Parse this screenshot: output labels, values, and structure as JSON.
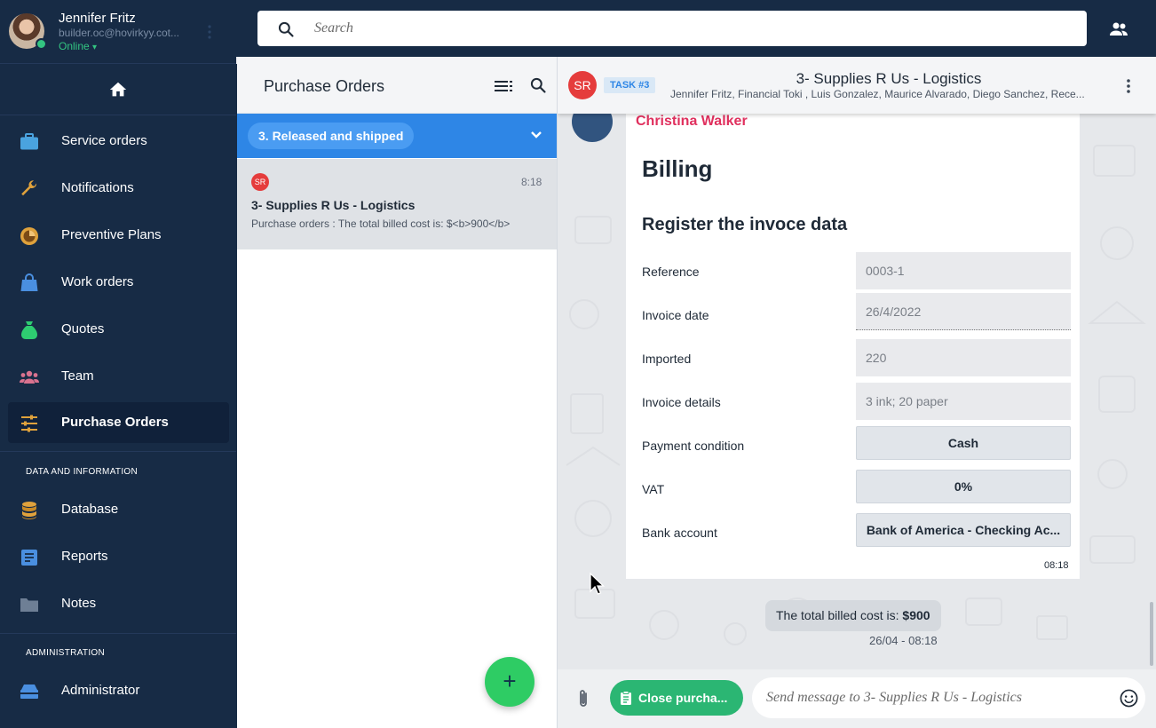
{
  "user": {
    "name": "Jennifer Fritz",
    "email": "builder.oc@hovirkyy.cot...",
    "status": "Online",
    "status_caret": "▾"
  },
  "search": {
    "placeholder": "Search"
  },
  "sidebar": {
    "items": [
      {
        "label": "Service orders",
        "icon": "briefcase-icon",
        "color": "#4aa3df"
      },
      {
        "label": "Notifications",
        "icon": "wrench-icon",
        "color": "#e0a23c"
      },
      {
        "label": "Preventive Plans",
        "icon": "gauge-icon",
        "color": "#e0a23c"
      },
      {
        "label": "Work orders",
        "icon": "bag-icon",
        "color": "#4a8fe0"
      },
      {
        "label": "Quotes",
        "icon": "money-bag-icon",
        "color": "#2ecc71"
      },
      {
        "label": "Team",
        "icon": "people-icon",
        "color": "#d9728f"
      },
      {
        "label": "Purchase Orders",
        "icon": "sliders-icon",
        "color": "#e0a23c"
      }
    ],
    "section_data": "DATA AND INFORMATION",
    "data_items": [
      {
        "label": "Database",
        "icon": "database-icon",
        "color": "#e0a23c"
      },
      {
        "label": "Reports",
        "icon": "report-icon",
        "color": "#4a8fe0"
      },
      {
        "label": "Notes",
        "icon": "folder-icon",
        "color": "#6e7f95"
      }
    ],
    "section_admin": "ADMINISTRATION",
    "admin_items": [
      {
        "label": "Administrator",
        "icon": "toolbox-icon",
        "color": "#4a8fe0"
      }
    ]
  },
  "list": {
    "title": "Purchase Orders",
    "status_filter": "3. Released and shipped",
    "order": {
      "badge": "SR",
      "time": "8:18",
      "title": "3- Supplies R Us - Logistics",
      "preview": "Purchase orders : The total billed cost is: $<b>900</b>"
    },
    "fab_label": "+"
  },
  "chat": {
    "badge": "SR",
    "task_tag": "TASK #3",
    "title": "3- Supplies R Us - Logistics",
    "members": "Jennifer Fritz, Financial Toki , Luis Gonzalez, Maurice Alvarado, Diego Sanchez, Rece...",
    "message": {
      "sender": "Christina Walker",
      "title": "Billing",
      "subtitle": "Register the invoce data",
      "fields": [
        {
          "label": "Reference",
          "value": "0003-1"
        },
        {
          "label": "Invoice date",
          "value": "26/4/2022"
        },
        {
          "label": "Imported",
          "value": "220"
        },
        {
          "label": "Invoice details",
          "value": "3 ink; 20 paper"
        },
        {
          "label": "Payment condition",
          "value": "Cash"
        },
        {
          "label": "VAT",
          "value": "0%"
        },
        {
          "label": "Bank account",
          "value": "Bank of America - Checking Ac..."
        }
      ],
      "time": "08:18"
    },
    "total_text": "The total billed cost is: ",
    "total_value": "$900",
    "total_time": "26/04 - 08:18",
    "close_button": "Close purcha...",
    "composer_placeholder": "Send message to 3- Supplies R Us - Logistics"
  }
}
